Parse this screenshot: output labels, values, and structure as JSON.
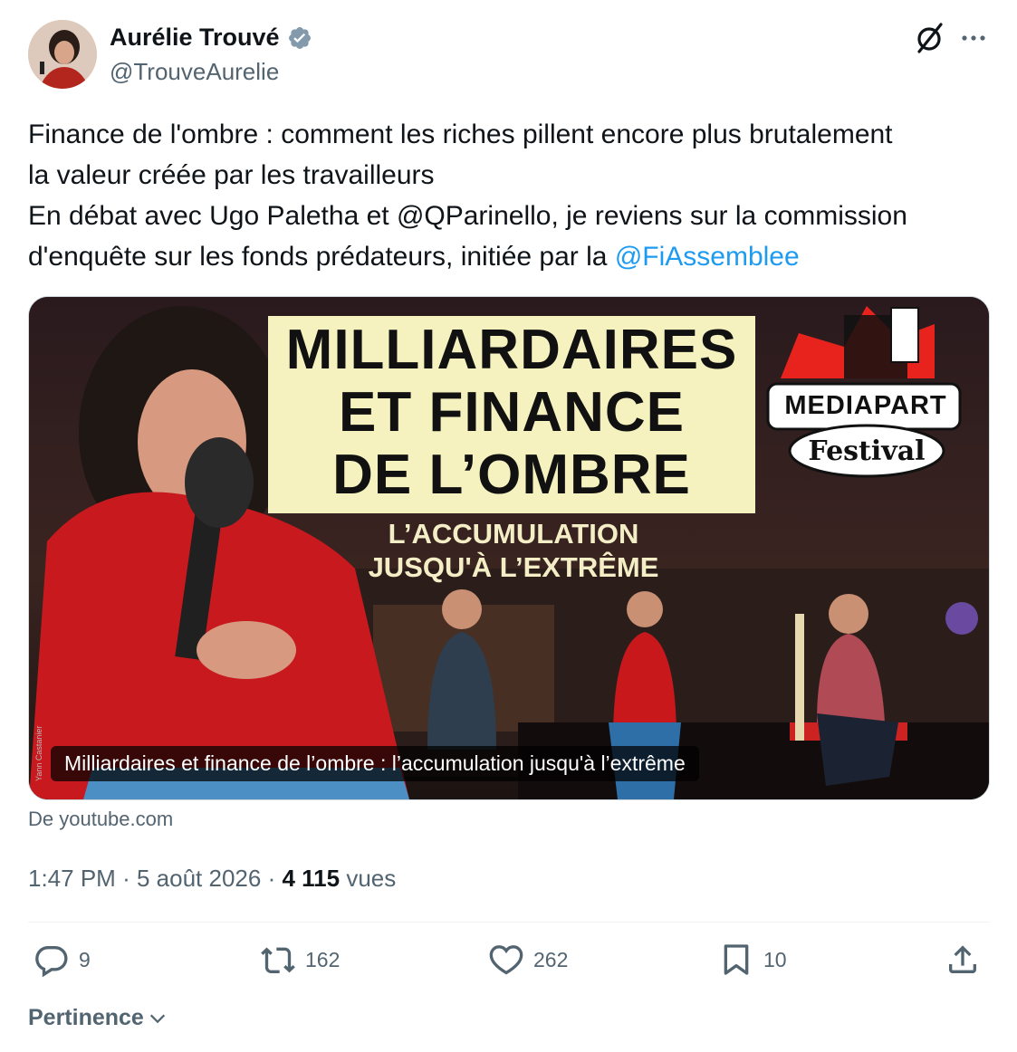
{
  "author": {
    "name": "Aurélie Trouvé",
    "handle": "@TrouveAurelie"
  },
  "tweet": {
    "line1": "Finance de l'ombre : comment les riches pillent encore plus brutalement",
    "line2": "la valeur créée par les travailleurs",
    "line3": "En débat avec Ugo Paletha et @QParinello, je reviens sur la commission",
    "line4_text": "d'enquête sur les fonds prédateurs, initiée par la ",
    "line4_mention": "@FiAssemblee"
  },
  "card": {
    "thumbnail_title_1": "MILLIARDAIRES",
    "thumbnail_title_2": "ET FINANCE",
    "thumbnail_title_3": "DE L’OMBRE",
    "thumbnail_sub_1": "L’ACCUMULATION",
    "thumbnail_sub_2": "JUSQU'À L’EXTRÊME",
    "festival_name": "MEDIAPART",
    "festival_word": "Festival",
    "photo_credit": "Yann Castanier",
    "caption": "Milliardaires et finance de l’ombre : l’accumulation jusqu'à l’extrême",
    "source": "De youtube.com"
  },
  "meta": {
    "time": "1:47 PM",
    "separator": "·",
    "date": "5 août 2026",
    "views_count": "4 115",
    "views_label": "vues"
  },
  "actions": {
    "replies": "9",
    "reposts": "162",
    "likes": "262",
    "bookmarks": "10"
  },
  "sort": {
    "label": "Pertinence"
  },
  "colors": {
    "link": "#1d9bf0",
    "secondary_text": "#536471",
    "verified": "#829aab"
  }
}
